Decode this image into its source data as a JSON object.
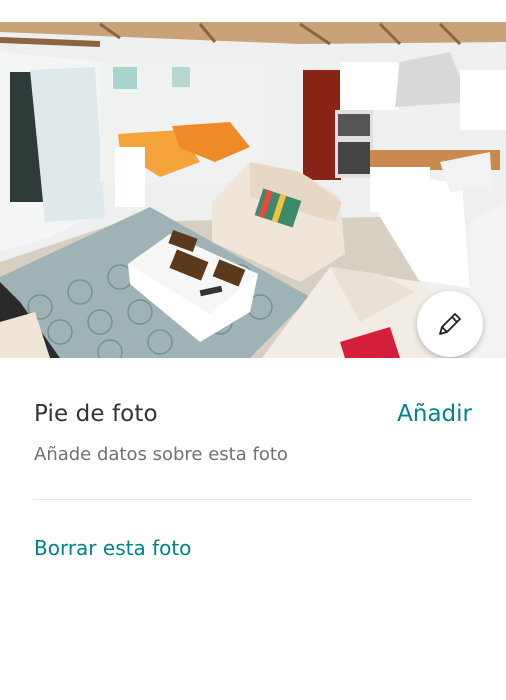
{
  "photo": {
    "alt": "",
    "edit_icon": "pencil-icon"
  },
  "caption": {
    "label": "Pie de foto",
    "add_label": "Añadir",
    "hint": "Añade datos sobre esta foto"
  },
  "actions": {
    "delete_label": "Borrar esta foto"
  },
  "colors": {
    "accent": "#00838a",
    "text_primary": "#333333",
    "text_secondary": "#717171"
  }
}
